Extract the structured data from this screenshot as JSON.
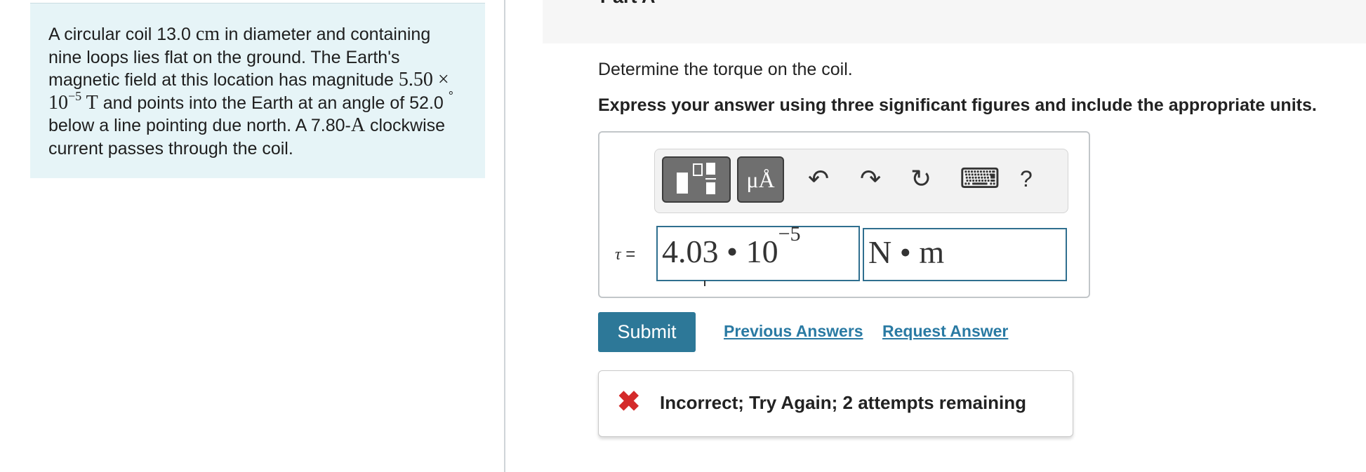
{
  "problem": {
    "t1": "A circular coil 13.0 ",
    "cm": "cm",
    "t2": " in diameter and containing nine loops lies flat on the ground. The Earth's magnetic field at this location has magnitude ",
    "field_mantissa": "5.50 × 10",
    "field_exp": "−5",
    "tesla": " T",
    "t3": " and points into the Earth at an angle of 52.0 ",
    "deg": "°",
    "t4": " below a line pointing due north. A 7.80-",
    "amp": "A",
    "t5": " clockwise current passes through the coil."
  },
  "part": {
    "title": "Part A",
    "chevron": "‹"
  },
  "question": "Determine the torque on the coil.",
  "instruction": "Express your answer using three significant figures and include the appropriate units.",
  "toolbar": {
    "units_label": "μÅ",
    "undo": "↶",
    "redo": "↷",
    "reset": "↻",
    "keyboard": "⌨",
    "help": "?"
  },
  "answer": {
    "var_label": "τ",
    "equals": " =",
    "value_mantissa": "4.03 • 10",
    "value_exp": "−5",
    "unit": "N • m"
  },
  "actions": {
    "submit": "Submit",
    "previous_answers": "Previous Answers",
    "request_answer": "Request Answer"
  },
  "feedback": {
    "icon": "✖",
    "text": "Incorrect; Try Again; 2 attempts remaining"
  }
}
